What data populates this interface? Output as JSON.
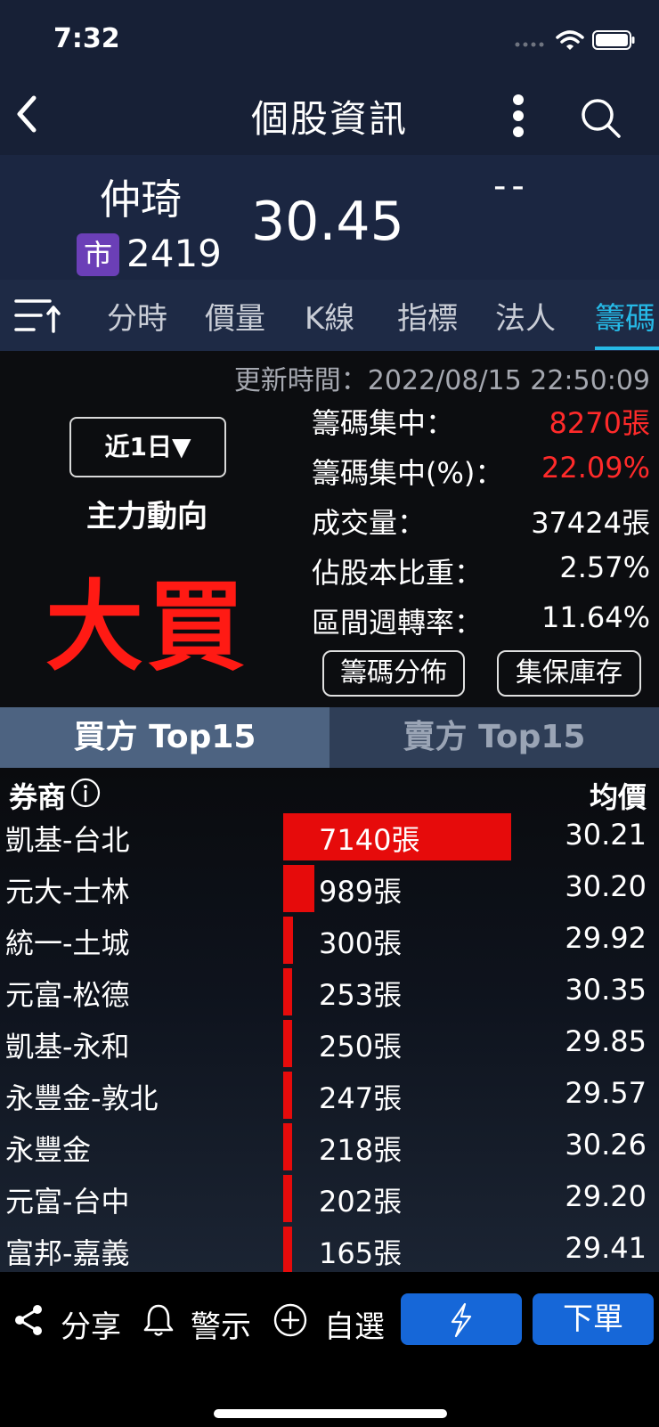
{
  "status": {
    "time": "7:32"
  },
  "nav": {
    "title": "個股資訊"
  },
  "stock": {
    "name": "仲琦",
    "market_badge": "市",
    "code": "2419",
    "price": "30.45",
    "change": "--"
  },
  "tabs": [
    {
      "label": "分時"
    },
    {
      "label": "價量"
    },
    {
      "label": "K線"
    },
    {
      "label": "指標"
    },
    {
      "label": "法人"
    },
    {
      "label": "籌碼",
      "active": true
    }
  ],
  "chips": {
    "update_time": "更新時間：2022/08/15 22:50:09",
    "period": "近1日▼",
    "main_force_label": "主力動向",
    "main_force_value": "大買",
    "stats": [
      {
        "label": "籌碼集中：",
        "value": "8270張",
        "highlight": true
      },
      {
        "label": "籌碼集中(%)：",
        "value": "22.09%",
        "highlight": true
      },
      {
        "label": "成交量：",
        "value": "37424張",
        "highlight": false
      },
      {
        "label": "佔股本比重：",
        "value": "2.57%",
        "highlight": false
      },
      {
        "label": "區間週轉率：",
        "value": "11.64%",
        "highlight": false
      }
    ],
    "dist_button": "籌碼分佈",
    "depository_button": "集保庫存"
  },
  "buy_sell": {
    "buy_tab": "買方 Top15",
    "sell_tab": "賣方 Top15"
  },
  "table": {
    "col_broker": "券商",
    "col_avg": "均價",
    "bar_max": 7140,
    "rows": [
      {
        "broker": "凱基-台北",
        "volume": "7140張",
        "vol": 7140,
        "avg": "30.21"
      },
      {
        "broker": "元大-士林",
        "volume": "989張",
        "vol": 989,
        "avg": "30.20"
      },
      {
        "broker": "統一-土城",
        "volume": "300張",
        "vol": 300,
        "avg": "29.92"
      },
      {
        "broker": "元富-松德",
        "volume": "253張",
        "vol": 253,
        "avg": "30.35"
      },
      {
        "broker": "凱基-永和",
        "volume": "250張",
        "vol": 250,
        "avg": "29.85"
      },
      {
        "broker": "永豐金-敦北",
        "volume": "247張",
        "vol": 247,
        "avg": "29.57"
      },
      {
        "broker": "永豐金",
        "volume": "218張",
        "vol": 218,
        "avg": "30.26"
      },
      {
        "broker": "元富-台中",
        "volume": "202張",
        "vol": 202,
        "avg": "29.20"
      },
      {
        "broker": "富邦-嘉義",
        "volume": "165張",
        "vol": 165,
        "avg": "29.41"
      }
    ]
  },
  "bottom": {
    "share": "分享",
    "alert": "警示",
    "watchlist": "自選",
    "order": "下單"
  },
  "colors": {
    "accent": "#26b9e6",
    "up_red": "#ff2a2a",
    "bar_red": "#e60b0b",
    "button_blue": "#1667d8"
  }
}
